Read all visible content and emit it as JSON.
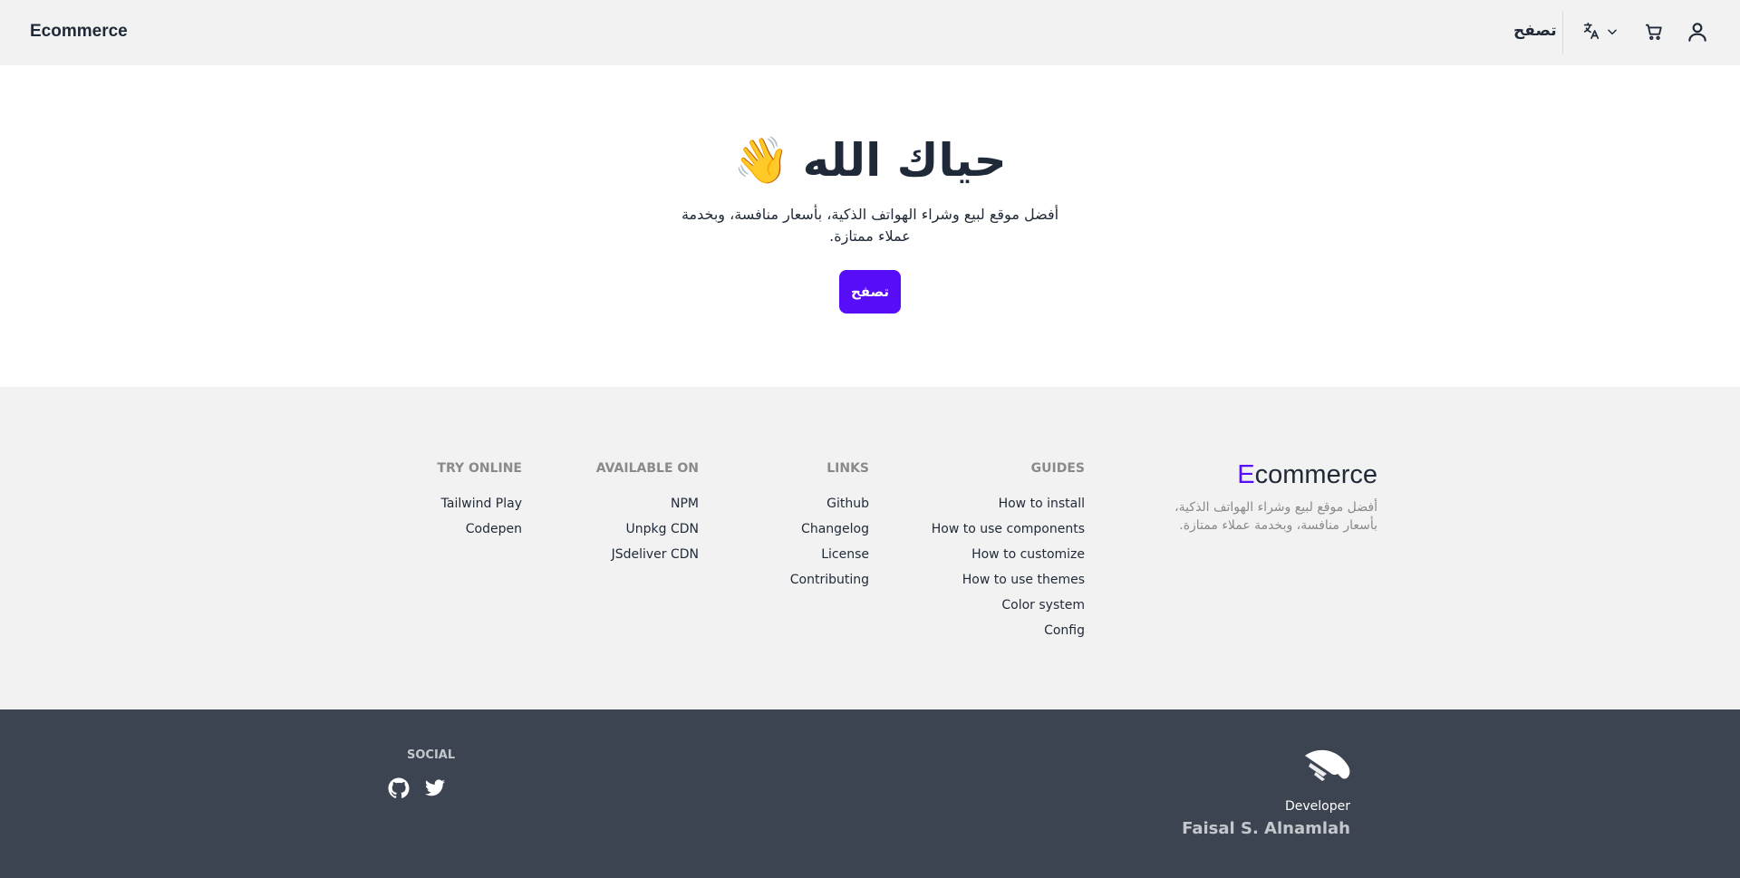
{
  "header": {
    "brand": "Ecommerce",
    "browse_link": "تصفح",
    "icons": [
      "translate-icon",
      "chevron-down-icon",
      "cart-icon",
      "user-icon"
    ]
  },
  "hero": {
    "title": "حياك الله",
    "emoji": "👋",
    "subtitle": "أفضل موقع لبيع وشراء الهواتف الذكية، بأسعار منافسة، وبخدمة عملاء ممتازة.",
    "button": "تصفح"
  },
  "footer": {
    "brand_first_letter": "E",
    "brand_rest": "commerce",
    "description": "أفضل موقع لبيع وشراء الهواتف الذكية، بأسعار منافسة، وبخدمة عملاء ممتازة.",
    "columns": {
      "guides": {
        "title": "GUIDES",
        "items": [
          "How to install",
          "How to use components",
          "How to customize",
          "How to use themes",
          "Color system",
          "Config"
        ]
      },
      "links": {
        "title": "LINKS",
        "items": [
          "Github",
          "Changelog",
          "License",
          "Contributing"
        ]
      },
      "available": {
        "title": "AVAILABLE ON",
        "items": [
          "NPM",
          "Unpkg CDN",
          "JSdeliver CDN"
        ]
      },
      "try": {
        "title": "TRY ONLINE",
        "items": [
          "Tailwind Play",
          "Codepen"
        ]
      }
    }
  },
  "footer_dark": {
    "social_title": "SOCIAL",
    "social_icons": [
      "github-icon",
      "twitter-icon"
    ],
    "developer_label": "Developer",
    "developer_name": "Faisal S. Alnamlah"
  },
  "colors": {
    "primary": "#570df8",
    "header_bg": "#f2f2f2",
    "dark_footer_bg": "#3d4451",
    "text": "#1f2937",
    "muted": "#8a8a8a"
  }
}
